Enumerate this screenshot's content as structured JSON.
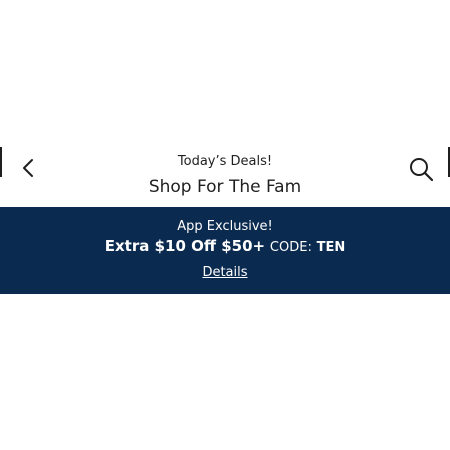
{
  "header": {
    "kicker": "Today’s Deals!",
    "title": "Shop For The Fam",
    "back_icon": "chevron-left-icon",
    "search_icon": "search-icon"
  },
  "promo_banner": {
    "kicker": "App Exclusive!",
    "offer": "Extra $10 Off $50+",
    "code_label": "CODE:",
    "code": "TEN",
    "details_link": "Details",
    "background_color": "#0b2a4f",
    "text_color": "#ffffff"
  }
}
